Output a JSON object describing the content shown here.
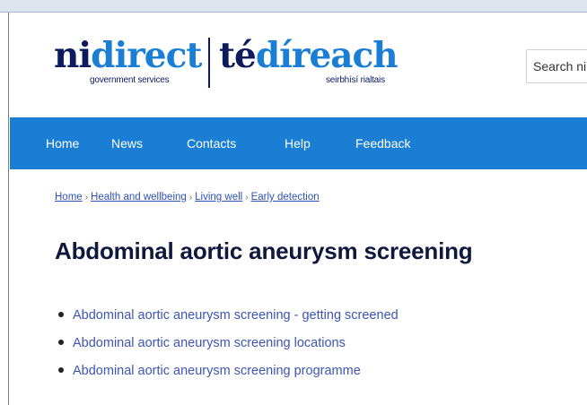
{
  "header": {
    "logo_ni": "ni",
    "logo_direct": "direct",
    "logo_sub_en": "government services",
    "logo_te": "té",
    "logo_direach": "díreach",
    "logo_sub_ga": "seirbhísí rialtais",
    "search_text": "Search ni"
  },
  "nav": {
    "items": [
      {
        "label": "Home"
      },
      {
        "label": "News"
      },
      {
        "label": "Contacts"
      },
      {
        "label": "Help"
      },
      {
        "label": "Feedback"
      }
    ]
  },
  "breadcrumb": {
    "items": [
      {
        "label": "Home"
      },
      {
        "label": "Health and wellbeing"
      },
      {
        "label": "Living well"
      },
      {
        "label": "Early detection"
      }
    ],
    "separator": "›"
  },
  "main": {
    "title": "Abdominal aortic aneurysm screening",
    "links": [
      {
        "label": "Abdominal aortic aneurysm screening - getting screened"
      },
      {
        "label": "Abdominal aortic aneurysm screening locations"
      },
      {
        "label": "Abdominal aortic aneurysm screening programme"
      }
    ]
  },
  "colors": {
    "brand_dark": "#0d1b5e",
    "brand_blue": "#1a7fd4",
    "link": "#3d55b5"
  }
}
